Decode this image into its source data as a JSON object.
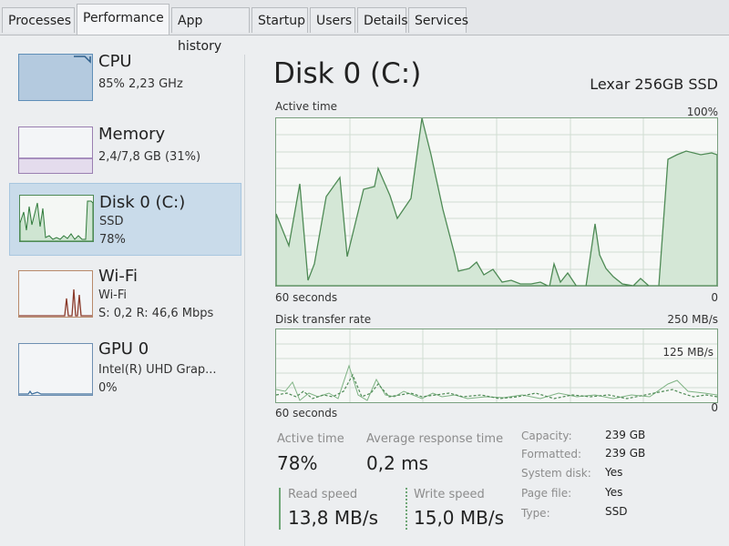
{
  "tabs": [
    {
      "label": "Processes"
    },
    {
      "label": "Performance"
    },
    {
      "label": "App history"
    },
    {
      "label": "Startup"
    },
    {
      "label": "Users"
    },
    {
      "label": "Details"
    },
    {
      "label": "Services"
    }
  ],
  "sidebar": {
    "cpu": {
      "title": "CPU",
      "line1": "85% 2,23 GHz"
    },
    "memory": {
      "title": "Memory",
      "line1": "2,4/7,8 GB (31%)"
    },
    "disk": {
      "title": "Disk 0 (C:)",
      "line1": "SSD",
      "line2": "78%"
    },
    "wifi": {
      "title": "Wi-Fi",
      "line1": "Wi-Fi",
      "line2": "S: 0,2  R: 46,6 Mbps"
    },
    "gpu": {
      "title": "GPU 0",
      "line1": "Intel(R) UHD Grap...",
      "line2": "0%"
    }
  },
  "main": {
    "title": "Disk 0 (C:)",
    "device": "Lexar 256GB SSD",
    "active_graph": {
      "label": "Active time",
      "max_label": "100%",
      "time_label": "60 seconds",
      "min_label": "0"
    },
    "transfer_graph": {
      "label": "Disk transfer rate",
      "max_label": "250 MB/s",
      "mid_label": "125 MB/s",
      "time_label": "60 seconds",
      "min_label": "0"
    },
    "stats": {
      "active_time_label": "Active time",
      "active_time_value": "78%",
      "avg_response_label": "Average response time",
      "avg_response_value": "0,2 ms",
      "read_speed_label": "Read speed",
      "read_speed_value": "13,8 MB/s",
      "write_speed_label": "Write speed",
      "write_speed_value": "15,0 MB/s"
    },
    "info": {
      "capacity_label": "Capacity:",
      "capacity_value": "239 GB",
      "formatted_label": "Formatted:",
      "formatted_value": "239 GB",
      "system_disk_label": "System disk:",
      "system_disk_value": "Yes",
      "page_file_label": "Page file:",
      "page_file_value": "Yes",
      "type_label": "Type:",
      "type_value": "SSD"
    }
  },
  "colors": {
    "disk_line": "#4e8a55",
    "disk_fill": "#d6e8d8",
    "selected_bg": "#c9dbea"
  }
}
